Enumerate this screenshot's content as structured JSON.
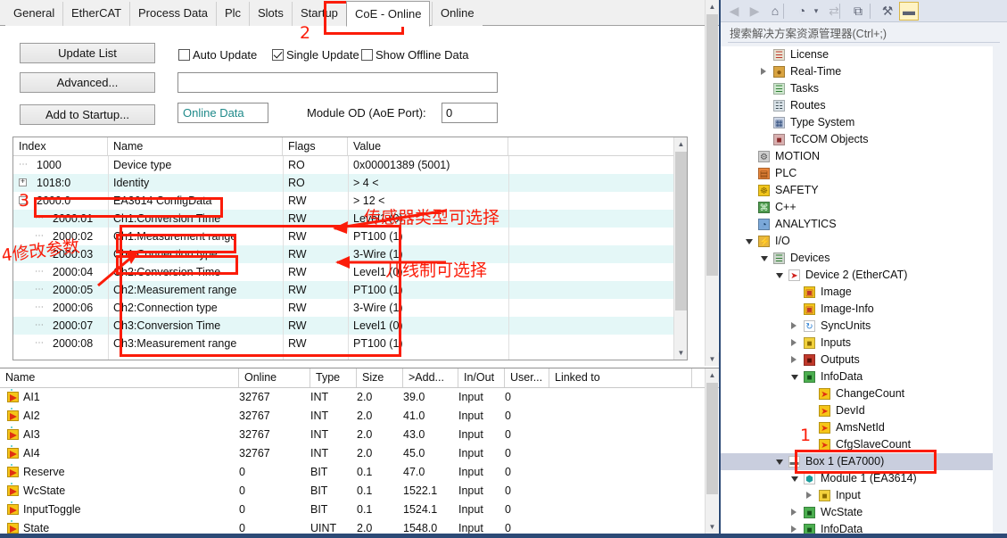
{
  "tabs": [
    {
      "label": "General",
      "active": false
    },
    {
      "label": "EtherCAT",
      "active": false
    },
    {
      "label": "Process Data",
      "active": false
    },
    {
      "label": "Plc",
      "active": false
    },
    {
      "label": "Slots",
      "active": false
    },
    {
      "label": "Startup",
      "active": false
    },
    {
      "label": "CoE - Online",
      "active": true
    },
    {
      "label": "Online",
      "active": false
    }
  ],
  "toolbar": {
    "update_list": "Update List",
    "advanced": "Advanced...",
    "add_to_startup": "Add to Startup...",
    "auto_update": "Auto Update",
    "auto_update_checked": false,
    "single_update": "Single Update",
    "single_update_checked": true,
    "show_offline_data": "Show Offline Data",
    "show_offline_data_checked": false,
    "filter_value": "",
    "online_data": "Online Data",
    "module_od_label": "Module OD (AoE Port):",
    "module_od_value": "0"
  },
  "coe_table": {
    "columns": [
      "Index",
      "Name",
      "Flags",
      "Value"
    ],
    "rows": [
      {
        "index": "1000",
        "name": "Device type",
        "flags": "RO",
        "value": "0x00001389 (5001)",
        "depth": 1,
        "expander": "",
        "alt": false
      },
      {
        "index": "1018:0",
        "name": "Identity",
        "flags": "RO",
        "value": "> 4 <",
        "depth": 1,
        "expander": "+",
        "alt": true
      },
      {
        "index": "2000:0",
        "name": "EA3614 ConfigData",
        "flags": "RW",
        "value": "> 12 <",
        "depth": 1,
        "expander": "-",
        "alt": false
      },
      {
        "index": "2000:01",
        "name": "Ch1:Conversion Time",
        "flags": "RW",
        "value": "Level1 (0)",
        "depth": 2,
        "expander": "",
        "alt": true
      },
      {
        "index": "2000:02",
        "name": "Ch1:Measurement range",
        "flags": "RW",
        "value": "PT100 (1)",
        "depth": 2,
        "expander": "",
        "alt": false
      },
      {
        "index": "2000:03",
        "name": "Ch1:Connection type",
        "flags": "RW",
        "value": "3-Wire (1)",
        "depth": 2,
        "expander": "",
        "alt": true
      },
      {
        "index": "2000:04",
        "name": "Ch2:Conversion Time",
        "flags": "RW",
        "value": "Level1 (0)",
        "depth": 2,
        "expander": "",
        "alt": false
      },
      {
        "index": "2000:05",
        "name": "Ch2:Measurement range",
        "flags": "RW",
        "value": "PT100 (1)",
        "depth": 2,
        "expander": "",
        "alt": true
      },
      {
        "index": "2000:06",
        "name": "Ch2:Connection type",
        "flags": "RW",
        "value": "3-Wire (1)",
        "depth": 2,
        "expander": "",
        "alt": false
      },
      {
        "index": "2000:07",
        "name": "Ch3:Conversion Time",
        "flags": "RW",
        "value": "Level1 (0)",
        "depth": 2,
        "expander": "",
        "alt": true
      },
      {
        "index": "2000:08",
        "name": "Ch3:Measurement range",
        "flags": "RW",
        "value": "PT100 (1)",
        "depth": 2,
        "expander": "",
        "alt": false
      }
    ]
  },
  "var_table": {
    "columns": [
      "Name",
      "Online",
      "Type",
      "Size",
      ">Add...",
      "In/Out",
      "User...",
      "Linked to"
    ],
    "rows": [
      {
        "name": "AI1",
        "online": "32767",
        "type": "INT",
        "size": "2.0",
        "addr": "39.0",
        "inout": "Input",
        "user": "0",
        "linked": ""
      },
      {
        "name": "AI2",
        "online": "32767",
        "type": "INT",
        "size": "2.0",
        "addr": "41.0",
        "inout": "Input",
        "user": "0",
        "linked": ""
      },
      {
        "name": "AI3",
        "online": "32767",
        "type": "INT",
        "size": "2.0",
        "addr": "43.0",
        "inout": "Input",
        "user": "0",
        "linked": ""
      },
      {
        "name": "AI4",
        "online": "32767",
        "type": "INT",
        "size": "2.0",
        "addr": "45.0",
        "inout": "Input",
        "user": "0",
        "linked": ""
      },
      {
        "name": "Reserve",
        "online": "0",
        "type": "BIT",
        "size": "0.1",
        "addr": "47.0",
        "inout": "Input",
        "user": "0",
        "linked": ""
      },
      {
        "name": "WcState",
        "online": "0",
        "type": "BIT",
        "size": "0.1",
        "addr": "1522.1",
        "inout": "Input",
        "user": "0",
        "linked": ""
      },
      {
        "name": "InputToggle",
        "online": "0",
        "type": "BIT",
        "size": "0.1",
        "addr": "1524.1",
        "inout": "Input",
        "user": "0",
        "linked": ""
      },
      {
        "name": "State",
        "online": "0",
        "type": "UINT",
        "size": "2.0",
        "addr": "1548.0",
        "inout": "Input",
        "user": "0",
        "linked": ""
      }
    ]
  },
  "sidebar": {
    "toolbar_icons": [
      {
        "name": "back-icon",
        "glyph": "◀",
        "state": "disabled"
      },
      {
        "name": "forward-icon",
        "glyph": "▶",
        "state": "disabled"
      },
      {
        "name": "home-icon",
        "glyph": "⌂",
        "state": "normal"
      },
      {
        "name": "pending-changes-icon",
        "glyph": "◔",
        "state": "normal"
      },
      {
        "name": "chevron-down-icon",
        "glyph": "▾",
        "state": "normal"
      },
      {
        "name": "sync-icon",
        "glyph": "⇄",
        "state": "disabled"
      },
      {
        "name": "collapse-all-icon",
        "glyph": "⧉",
        "state": "normal"
      },
      {
        "name": "properties-icon",
        "glyph": "⚒",
        "state": "normal"
      },
      {
        "name": "preview-icon",
        "glyph": "▬",
        "state": "active"
      }
    ],
    "search_placeholder": "搜索解决方案资源管理器(Ctrl+;)",
    "tree": [
      {
        "label": "License",
        "depth": 3,
        "arrow": "",
        "icon": "license",
        "sel": false
      },
      {
        "label": "Real-Time",
        "depth": 3,
        "arrow": "closed",
        "icon": "realtime",
        "sel": false
      },
      {
        "label": "Tasks",
        "depth": 3,
        "arrow": "",
        "icon": "tasks",
        "sel": false
      },
      {
        "label": "Routes",
        "depth": 3,
        "arrow": "",
        "icon": "routes",
        "sel": false
      },
      {
        "label": "Type System",
        "depth": 3,
        "arrow": "",
        "icon": "typesystem",
        "sel": false
      },
      {
        "label": "TcCOM Objects",
        "depth": 3,
        "arrow": "",
        "icon": "tccom",
        "sel": false
      },
      {
        "label": "MOTION",
        "depth": 2,
        "arrow": "",
        "icon": "motion",
        "sel": false
      },
      {
        "label": "PLC",
        "depth": 2,
        "arrow": "",
        "icon": "plc",
        "sel": false
      },
      {
        "label": "SAFETY",
        "depth": 2,
        "arrow": "",
        "icon": "safety",
        "sel": false
      },
      {
        "label": "C++",
        "depth": 2,
        "arrow": "",
        "icon": "cpp",
        "sel": false
      },
      {
        "label": "ANALYTICS",
        "depth": 2,
        "arrow": "",
        "icon": "analytics",
        "sel": false
      },
      {
        "label": "I/O",
        "depth": 2,
        "arrow": "open",
        "icon": "io",
        "sel": false
      },
      {
        "label": "Devices",
        "depth": 3,
        "arrow": "open",
        "icon": "devices",
        "sel": false
      },
      {
        "label": "Device 2 (EtherCAT)",
        "depth": 4,
        "arrow": "open",
        "icon": "ethercat",
        "sel": false
      },
      {
        "label": "Image",
        "depth": 5,
        "arrow": "",
        "icon": "image",
        "sel": false
      },
      {
        "label": "Image-Info",
        "depth": 5,
        "arrow": "",
        "icon": "image",
        "sel": false
      },
      {
        "label": "SyncUnits",
        "depth": 5,
        "arrow": "closed",
        "icon": "sync",
        "sel": false
      },
      {
        "label": "Inputs",
        "depth": 5,
        "arrow": "closed",
        "icon": "inputs",
        "sel": false
      },
      {
        "label": "Outputs",
        "depth": 5,
        "arrow": "closed",
        "icon": "outputs",
        "sel": false
      },
      {
        "label": "InfoData",
        "depth": 5,
        "arrow": "open",
        "icon": "infodata",
        "sel": false
      },
      {
        "label": "ChangeCount",
        "depth": 6,
        "arrow": "",
        "icon": "var",
        "sel": false
      },
      {
        "label": "DevId",
        "depth": 6,
        "arrow": "",
        "icon": "var",
        "sel": false
      },
      {
        "label": "AmsNetId",
        "depth": 6,
        "arrow": "",
        "icon": "var",
        "sel": false
      },
      {
        "label": "CfgSlaveCount",
        "depth": 6,
        "arrow": "",
        "icon": "var",
        "sel": false
      },
      {
        "label": "Box 1 (EA7000)",
        "depth": 4,
        "arrow": "open",
        "icon": "box",
        "sel": true
      },
      {
        "label": "Module 1 (EA3614)",
        "depth": 5,
        "arrow": "open",
        "icon": "module",
        "sel": false
      },
      {
        "label": "Input",
        "depth": 6,
        "arrow": "closed",
        "icon": "inputs",
        "sel": false
      },
      {
        "label": "WcState",
        "depth": 5,
        "arrow": "closed",
        "icon": "infodata",
        "sel": false
      },
      {
        "label": "InfoData",
        "depth": 5,
        "arrow": "closed",
        "icon": "infodata",
        "sel": false
      }
    ]
  },
  "annotations": {
    "num1": "1",
    "num2": "2",
    "num3": "3",
    "text_modify_params": "4修改参数",
    "text_sensor_type": "传感器类型可选择",
    "text_wire_mode": "几线制可选择",
    "color": "#fb1c09"
  }
}
